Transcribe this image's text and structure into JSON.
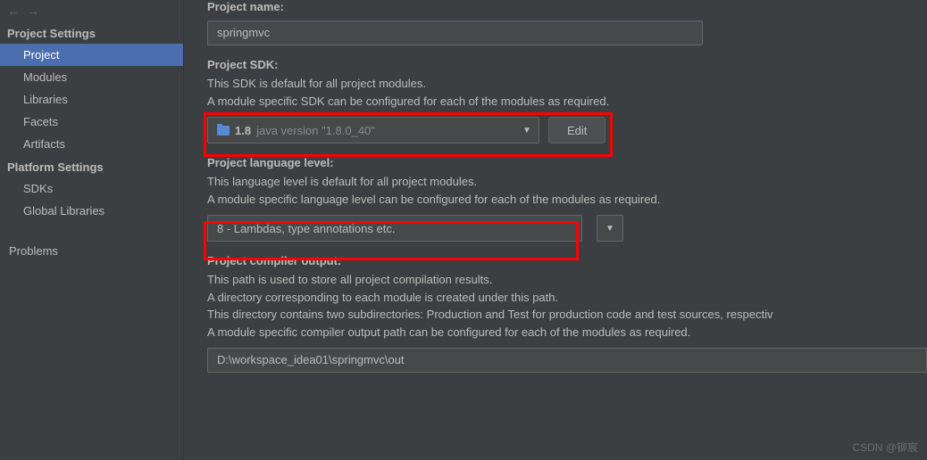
{
  "nav": {
    "back": "←",
    "forward": "→"
  },
  "sidebar": {
    "section1": "Project Settings",
    "items1": [
      "Project",
      "Modules",
      "Libraries",
      "Facets",
      "Artifacts"
    ],
    "section2": "Platform Settings",
    "items2": [
      "SDKs",
      "Global Libraries"
    ],
    "problems": "Problems"
  },
  "main": {
    "projectName": {
      "label": "Project name:",
      "value": "springmvc"
    },
    "projectSdk": {
      "label": "Project SDK:",
      "desc1": "This SDK is default for all project modules.",
      "desc2": "A module specific SDK can be configured for each of the modules as required.",
      "version": "1.8",
      "detail": "java version \"1.8.0_40\"",
      "editBtn": "Edit"
    },
    "langLevel": {
      "label": "Project language level:",
      "desc1": "This language level is default for all project modules.",
      "desc2": "A module specific language level can be configured for each of the modules as required.",
      "value": "8 - Lambdas, type annotations etc."
    },
    "compilerOut": {
      "label": "Project compiler output:",
      "desc1": "This path is used to store all project compilation results.",
      "desc2": "A directory corresponding to each module is created under this path.",
      "desc3": "This directory contains two subdirectories: Production and Test for production code and test sources, respectiv",
      "desc4": "A module specific compiler output path can be configured for each of the modules as required.",
      "value": "D:\\workspace_idea01\\springmvc\\out"
    }
  },
  "watermark": "CSDN @铆宸"
}
